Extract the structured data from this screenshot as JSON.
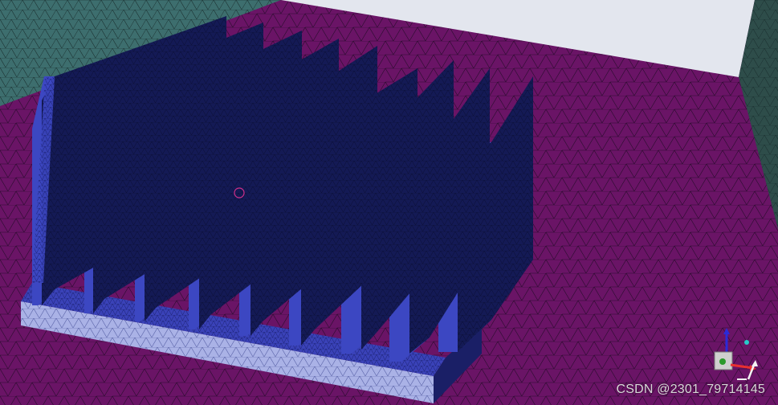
{
  "viewport": {
    "colors": {
      "floor": "#6a1466",
      "floor_mesh": "#1c0a22",
      "left_wall": "#3d6e6e",
      "right_wall": "#2e4d4a",
      "sky": "#e3e6ee",
      "fin_face": "#141a55",
      "fin_edge": "#3c47c2",
      "base_top": "#3a42b8",
      "base_bottom": "#aab2e6",
      "mesh_line": "#0c0c2a",
      "cursor": "#d0308a"
    },
    "fins": 10,
    "mesh": "heat-sink surface mesh"
  },
  "watermark": "CSDN @2301_79714145",
  "triad": {
    "icon": "coordinate-triad-icon",
    "axis_colors": {
      "x": "#e83030",
      "y": "#f2f2f2",
      "z": "#2a2ad8",
      "marker": "#27c9c9",
      "origin": "#2b9a2b"
    }
  }
}
